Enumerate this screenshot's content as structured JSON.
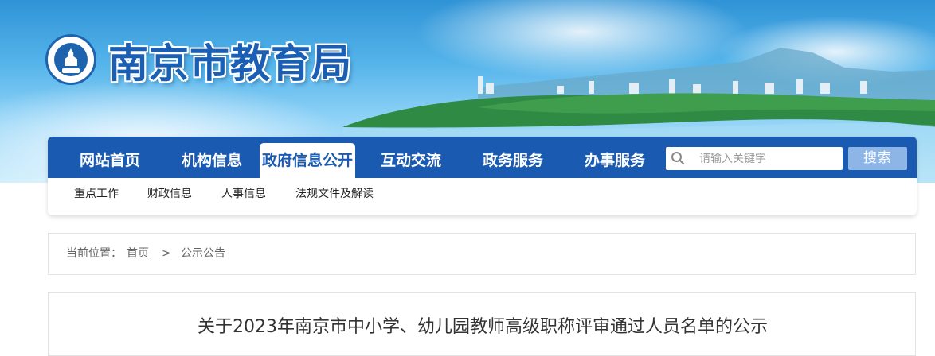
{
  "header": {
    "site_title": "南京市教育局",
    "logo_icon": "nanjing-education-emblem"
  },
  "nav": {
    "items": [
      {
        "label": "网站首页",
        "active": false
      },
      {
        "label": "机构信息",
        "active": false
      },
      {
        "label": "政府信息公开",
        "active": true
      },
      {
        "label": "互动交流",
        "active": false
      },
      {
        "label": "政务服务",
        "active": false
      },
      {
        "label": "办事服务",
        "active": false
      }
    ],
    "search": {
      "placeholder": "请输入关键字",
      "button_label": "搜索",
      "icon": "search-icon"
    },
    "subitems": [
      {
        "label": "重点工作"
      },
      {
        "label": "财政信息"
      },
      {
        "label": "人事信息"
      },
      {
        "label": "法规文件及解读"
      }
    ]
  },
  "breadcrumb": {
    "prefix": "当前位置：",
    "home": "首页",
    "separator": ">",
    "current": "公示公告"
  },
  "article": {
    "title": "关于2023年南京市中小学、幼儿园教师高级职称评审通过人员名单的公示"
  },
  "colors": {
    "nav_blue": "#1a5ab1",
    "title_blue": "#1a5fb4",
    "search_button": "#8db5e6"
  }
}
